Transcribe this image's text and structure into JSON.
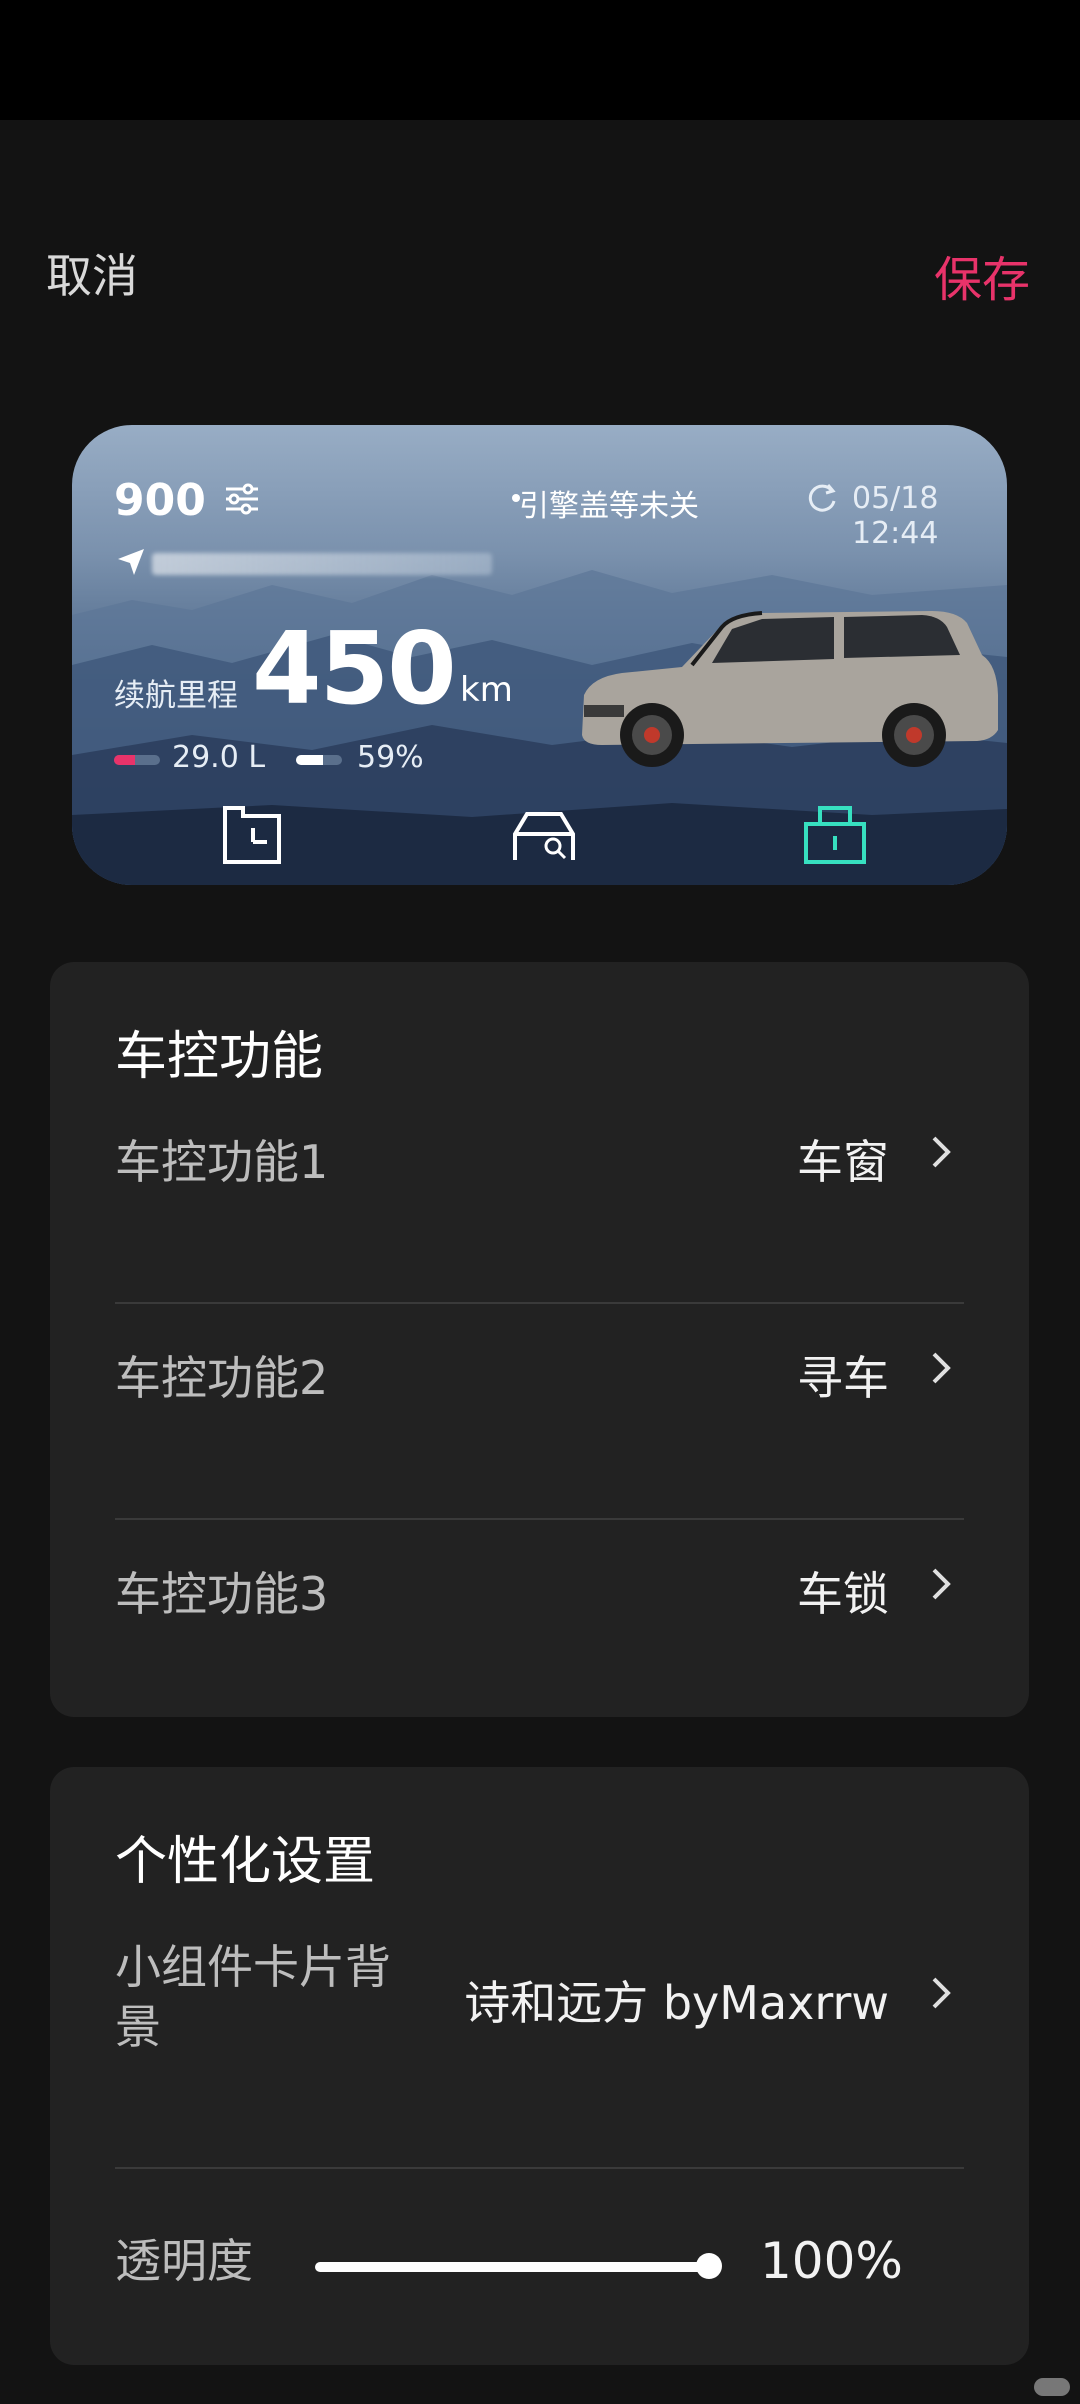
{
  "header": {
    "cancel_label": "取消",
    "save_label": "保存"
  },
  "widget": {
    "model": "900",
    "alert": "引擎盖等未关",
    "timestamp": "05/18 12:44",
    "range_label": "续航里程",
    "range_value": "450",
    "range_unit": "km",
    "fuel_value": "29.0 L",
    "fuel_level": 0.45,
    "battery_value": "59%",
    "battery_level": 0.59
  },
  "vehicle_control": {
    "title": "车控功能",
    "items": [
      {
        "label": "车控功能1",
        "value": "车窗"
      },
      {
        "label": "车控功能2",
        "value": "寻车"
      },
      {
        "label": "车控功能3",
        "value": "车锁"
      }
    ]
  },
  "personalization": {
    "title": "个性化设置",
    "background_label_line1": "小组件卡片背",
    "background_label_line2": "景",
    "background_value": "诗和远方 byMaxrrw",
    "opacity_label": "透明度",
    "opacity_value": "100%",
    "opacity_level": 1.0
  },
  "colors": {
    "accent": "#e8336a",
    "lock_icon": "#37e0c0",
    "background": "#131313",
    "panel": "#222222"
  }
}
